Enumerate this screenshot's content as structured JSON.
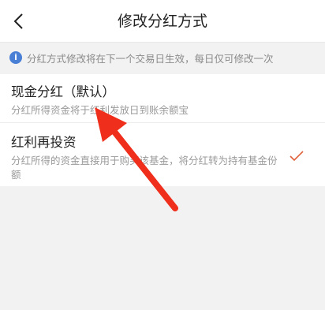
{
  "header": {
    "title": "修改分红方式"
  },
  "notice": {
    "text": "分红方式修改将在下一个交易日生效，每日仅可修改一次"
  },
  "options": [
    {
      "title": "现金分红（默认）",
      "desc": "分红所得资金将于红利发放日到账余额宝",
      "selected": false
    },
    {
      "title": "红利再投资",
      "desc": "分红所得的资金直接用于购买该基金，将分红转为持有基金份额",
      "selected": true
    }
  ],
  "colors": {
    "check": "#e0603a",
    "arrow": "#ef2f1c",
    "info": "#4a7fd6"
  },
  "icons": {
    "back": "chevron-left-icon",
    "info": "info-icon",
    "check": "checkmark-icon"
  }
}
